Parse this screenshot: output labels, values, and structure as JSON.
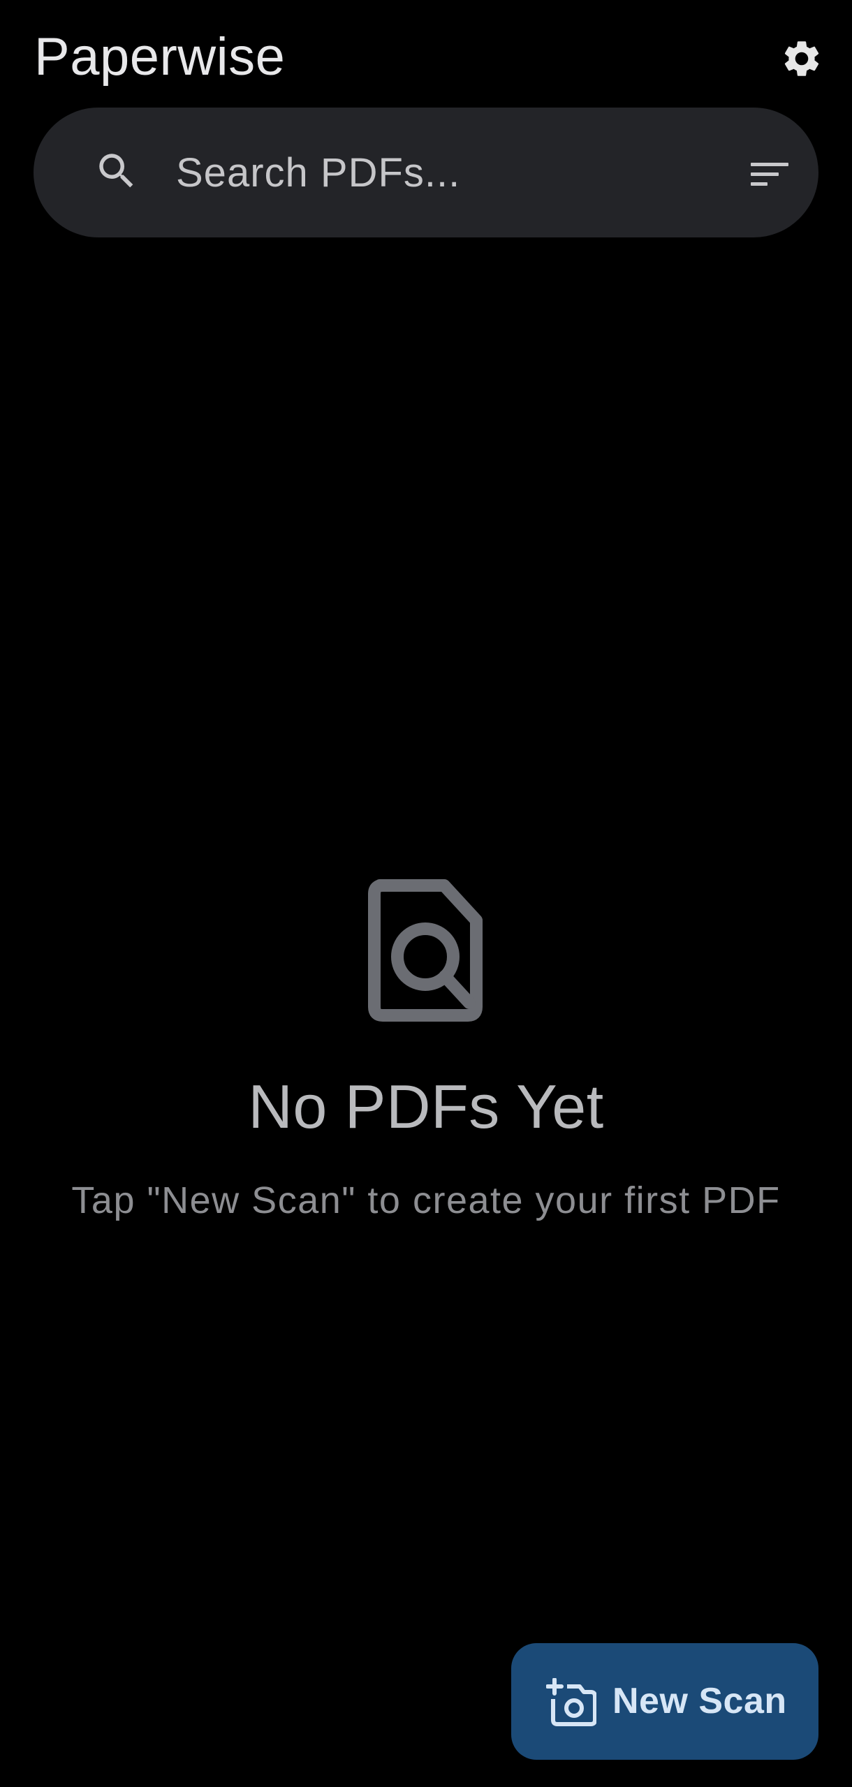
{
  "app": {
    "title": "Paperwise"
  },
  "header": {
    "settings_icon": "gear-icon"
  },
  "search": {
    "placeholder": "Search PDFs...",
    "value": "",
    "search_icon": "search-icon",
    "filter_icon": "sort-filter-icon"
  },
  "empty_state": {
    "icon": "document-search-icon",
    "title": "No PDFs Yet",
    "subtitle": "Tap \"New Scan\" to create your first PDF"
  },
  "fab": {
    "label": "New Scan",
    "icon": "add-camera-icon"
  },
  "colors": {
    "background": "#000000",
    "search_bar": "#232428",
    "fab_background": "#1b4a77",
    "fab_text": "#d7e6f6",
    "empty_icon": "#6b6d73"
  }
}
